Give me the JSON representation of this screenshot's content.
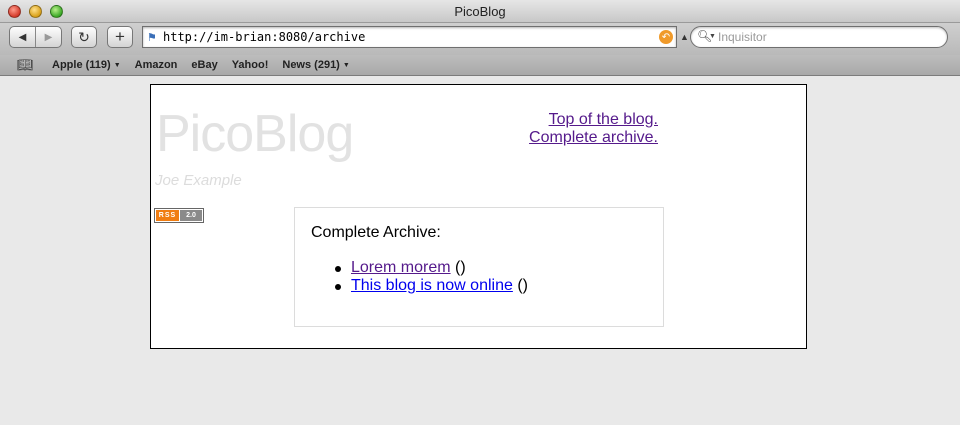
{
  "window": {
    "title": "PicoBlog"
  },
  "toolbar": {
    "back_icon": "back-arrow-icon",
    "forward_icon": "forward-arrow-icon",
    "address": "http://im-brian:8080/archive",
    "search_placeholder": "Inquisitor"
  },
  "bookmarks": {
    "items": [
      {
        "label": "Apple (119)",
        "dropdown": true
      },
      {
        "label": "Amazon",
        "dropdown": false
      },
      {
        "label": "eBay",
        "dropdown": false
      },
      {
        "label": "Yahoo!",
        "dropdown": false
      },
      {
        "label": "News (291)",
        "dropdown": true
      }
    ]
  },
  "blog": {
    "title": "PicoBlog",
    "author": "Joe Example",
    "links": {
      "top": "Top of the blog.",
      "archive": "Complete archive."
    },
    "rss": {
      "left": "RSS",
      "right": "2.0"
    }
  },
  "archive": {
    "heading": "Complete Archive:",
    "posts": [
      {
        "title": "Lorem morem",
        "suffix": " ()",
        "visited": true
      },
      {
        "title": "This blog is now online",
        "suffix": " ()",
        "visited": false
      }
    ]
  },
  "colors": {
    "visited_link": "#551a8b",
    "link": "#0000ee",
    "rss_orange": "#f07d12"
  }
}
